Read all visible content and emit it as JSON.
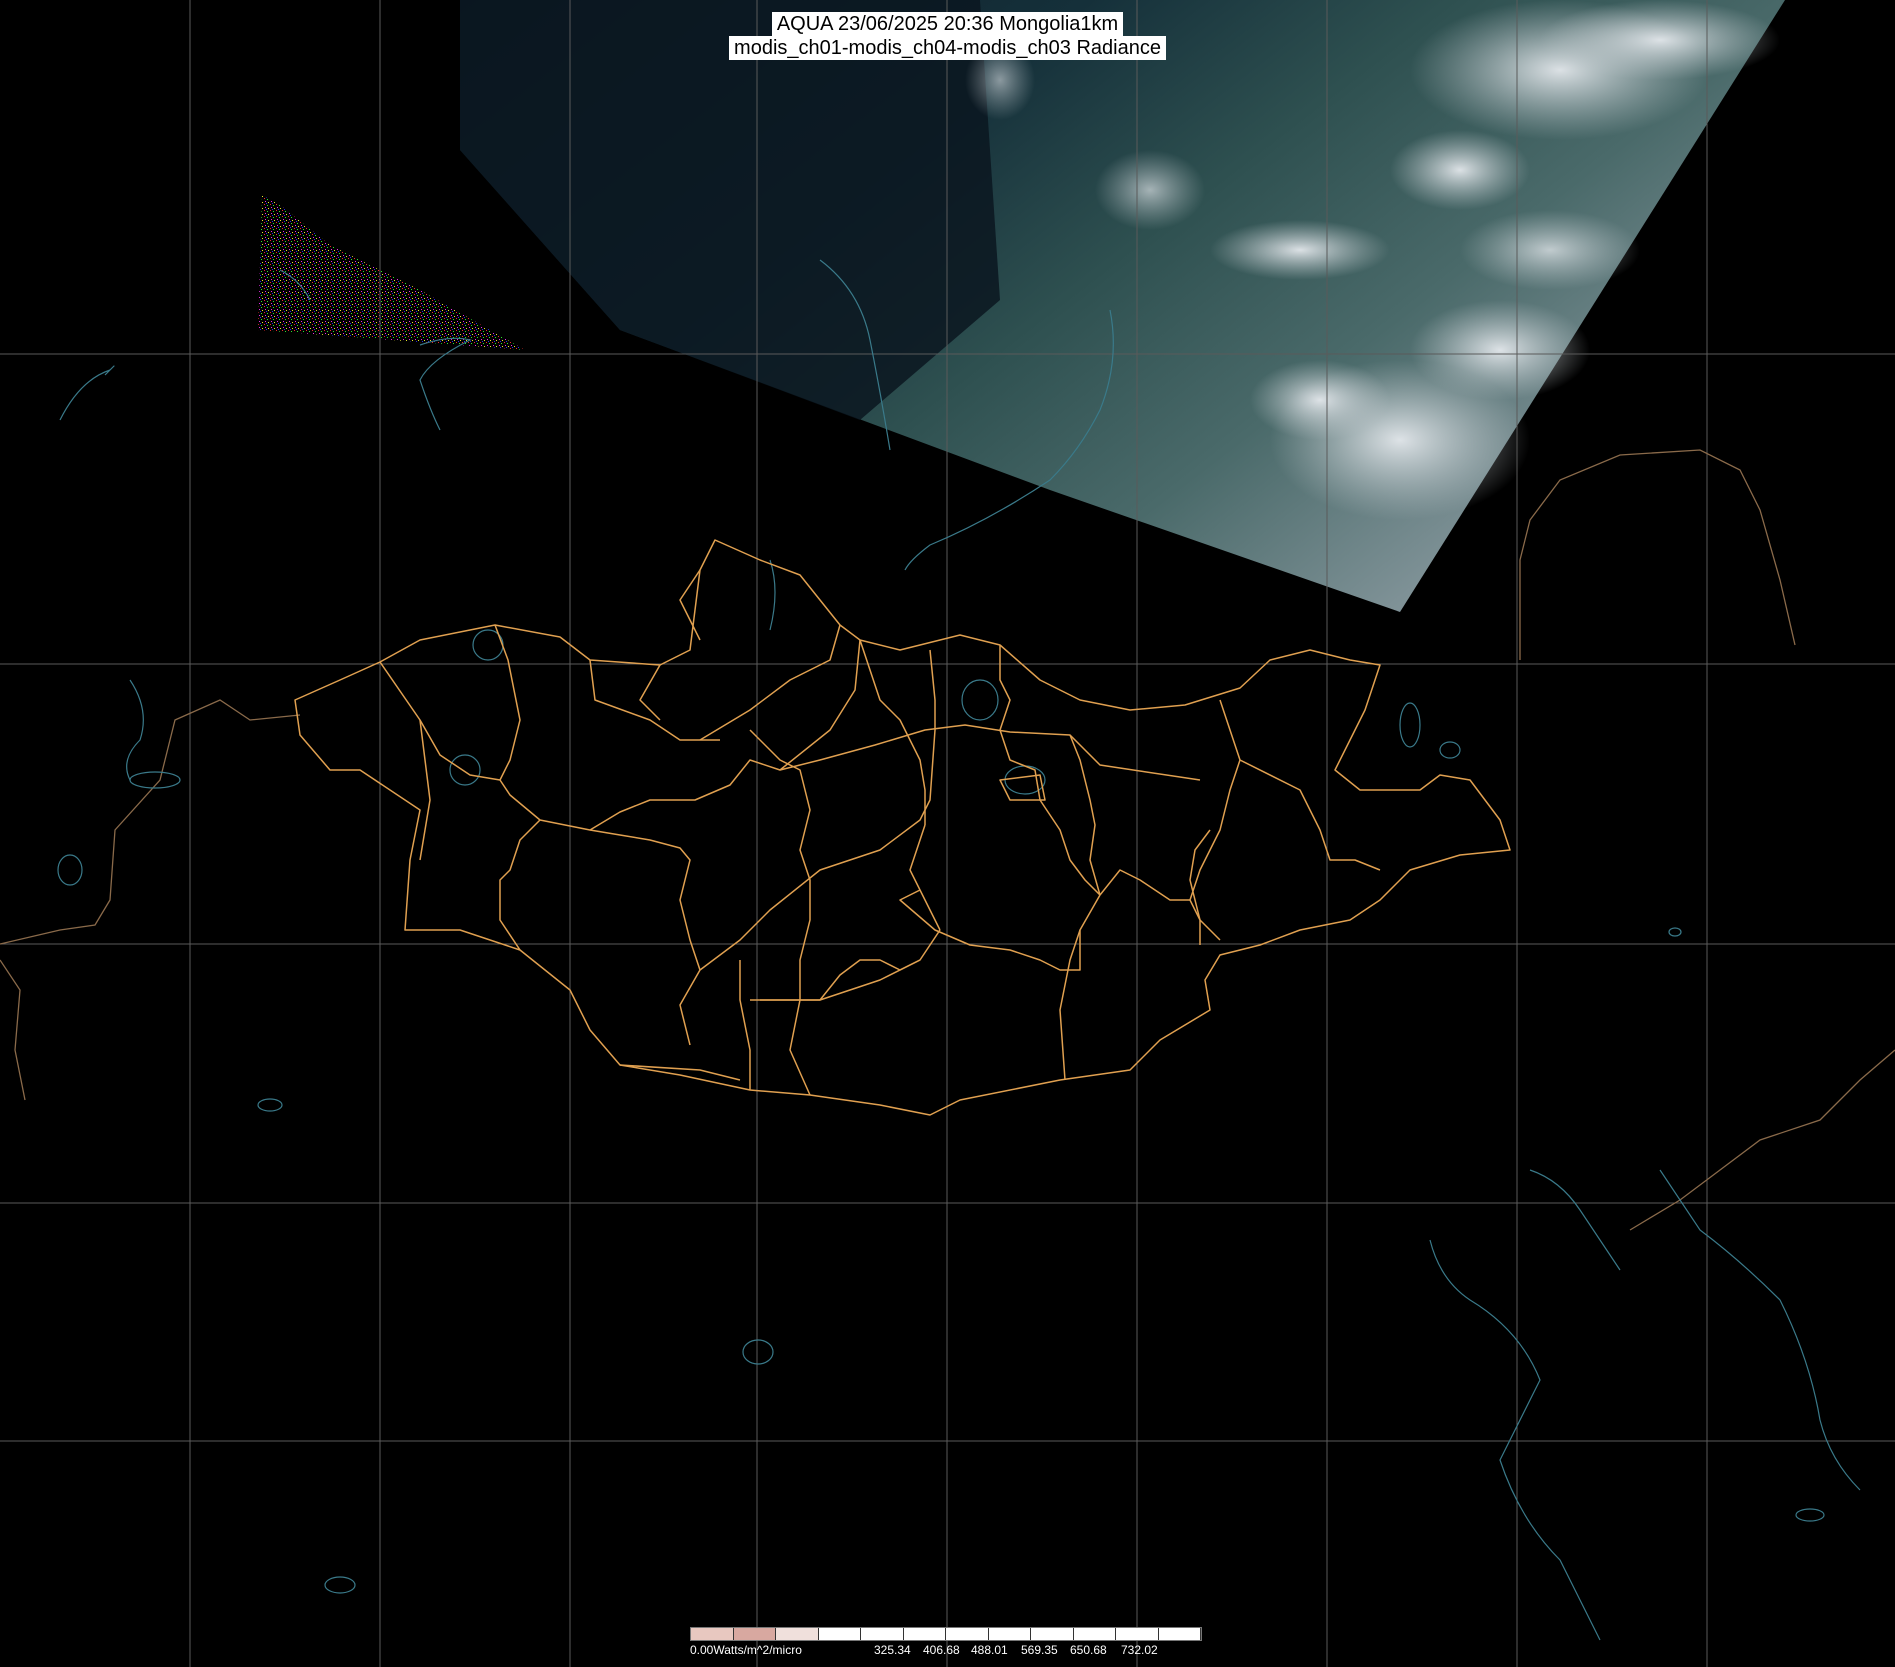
{
  "title": {
    "line1": "AQUA 23/06/2025 20:36 Mongolia1km",
    "line2": "modis_ch01-modis_ch04-modis_ch03 Radiance"
  },
  "legend": {
    "min_label": "0.00Watts/m^2/micro",
    "tick_labels": [
      "325.34",
      "406.68",
      "488.01",
      "569.35",
      "650.68",
      "732.02"
    ],
    "colors": [
      "#e8c8c0",
      "#d8a8a0",
      "#f0e0dc",
      "#ffffff",
      "#ffffff",
      "#ffffff",
      "#ffffff",
      "#ffffff",
      "#ffffff",
      "#ffffff",
      "#ffffff",
      "#ffffff"
    ]
  },
  "colors": {
    "background": "#000000",
    "grid": "#5a5a5a",
    "province_borders": "#e0a050",
    "coastlines_rivers": "#3a7a8a",
    "national_borders_outside": "#8a6a4a",
    "swath_dark": "#0e1e2a",
    "swath_land": "#3a5a5a",
    "cloud": "#d0d8e0"
  },
  "map_layers": [
    "satellite-swath",
    "grid-lines",
    "coastlines-lakes-rivers",
    "mongolia-province-borders",
    "neighboring-country-borders"
  ]
}
